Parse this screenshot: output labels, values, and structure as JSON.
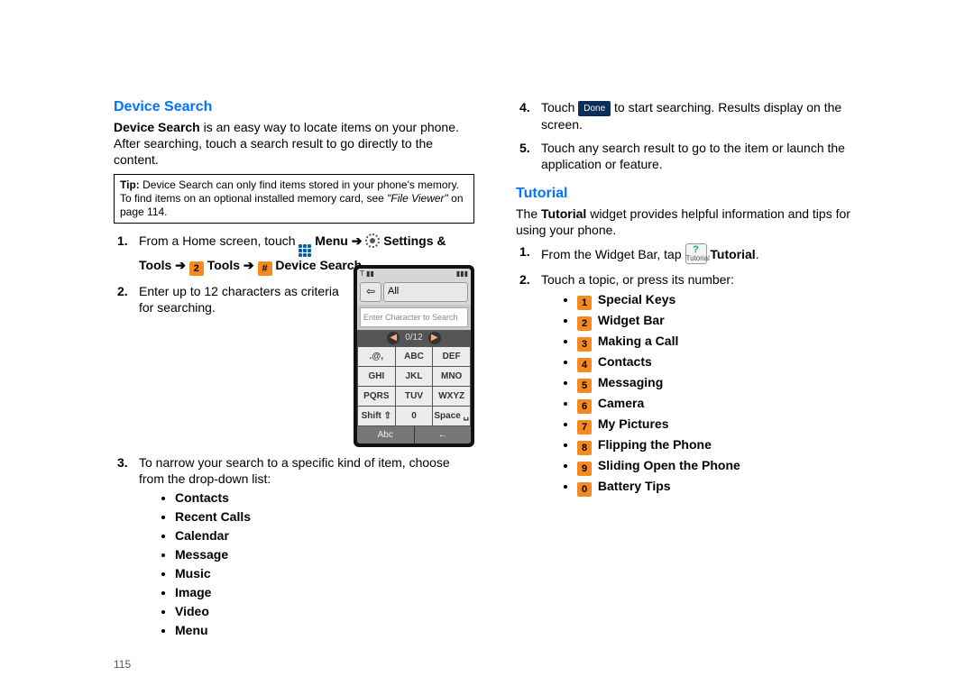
{
  "page_number": "115",
  "left": {
    "heading": "Device Search",
    "intro_bold": "Device Search",
    "intro_rest": " is an easy way to locate items on your phone. After searching, touch a search result to go directly to the content.",
    "tip_label": "Tip:",
    "tip_text_1": " Device Search can only find items stored in your phone's memory. To find items on an optional installed memory card, see ",
    "tip_ref": "\"File Viewer\"",
    "tip_text_2": " on page 114.",
    "step1_a": "From a Home screen, touch ",
    "step1_menu": "Menu",
    "step1_arrow": " ➔ ",
    "step1_settings": "Settings & Tools",
    "step1_key2": "2",
    "step1_tools": "Tools",
    "step1_keyhash": "#",
    "step1_ds": "Device Search",
    "step2": "Enter up to 12 characters as criteria for searching.",
    "step3": "To narrow your search to a specific kind of item, choose from the drop-down list:",
    "categories": [
      "Contacts",
      "Recent Calls",
      "Calendar",
      "Message",
      "Music",
      "Image",
      "Video",
      "Menu"
    ],
    "phone": {
      "all": "All",
      "back": "⇦",
      "entry_placeholder": "Enter Character to Search",
      "counter": "0/12",
      "left_arrow": "◀",
      "right_arrow": "▶",
      "keys": [
        ".@,",
        "ABC",
        "DEF",
        "GHI",
        "JKL",
        "MNO",
        "PQRS",
        "TUV",
        "WXYZ",
        "Shift ⇧",
        "0",
        "Space ␣"
      ],
      "bottom_left": "Abc",
      "bottom_right": "←",
      "sig": "T ▮▮",
      "batt": "▮▮▮"
    }
  },
  "right": {
    "step4_a": "Touch ",
    "step4_done": "Done",
    "step4_b": " to start searching. Results display on the screen.",
    "step5": "Touch any search result to go to the item or launch the application or feature.",
    "heading2": "Tutorial",
    "tut_intro_a": "The ",
    "tut_intro_bold": "Tutorial",
    "tut_intro_b": " widget provides helpful information and tips for using your phone.",
    "tut_step1_a": "From the Widget Bar, tap ",
    "tut_badge_q": "?",
    "tut_badge_text": "Tutorial",
    "tut_step1_b": "Tutorial",
    "tut_step2": "Touch a topic, or press its number:",
    "topics": [
      {
        "n": "1",
        "label": "Special Keys"
      },
      {
        "n": "2",
        "label": "Widget Bar"
      },
      {
        "n": "3",
        "label": "Making a Call"
      },
      {
        "n": "4",
        "label": "Contacts"
      },
      {
        "n": "5",
        "label": "Messaging"
      },
      {
        "n": "6",
        "label": "Camera"
      },
      {
        "n": "7",
        "label": "My Pictures"
      },
      {
        "n": "8",
        "label": "Flipping the Phone"
      },
      {
        "n": "9",
        "label": "Sliding Open the Phone"
      },
      {
        "n": "0",
        "label": "Battery Tips"
      }
    ]
  }
}
